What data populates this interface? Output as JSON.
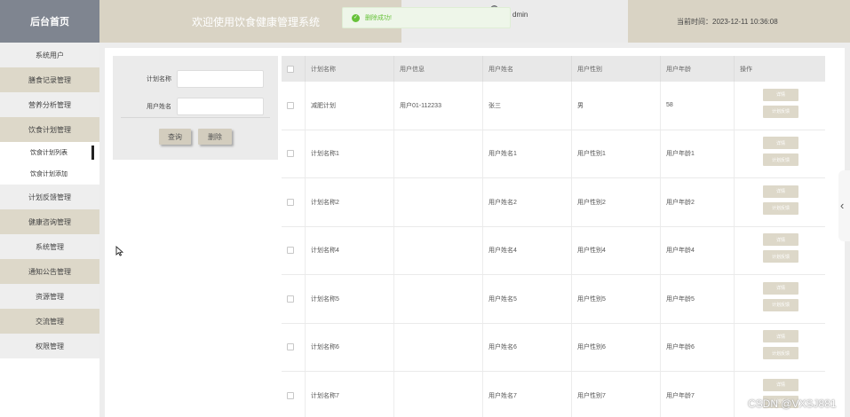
{
  "header": {
    "logo": "后台首页",
    "system_title": "欢迎使用饮食健康管理系统",
    "user_name": "dmin",
    "time_label": "当前时间：2023-12-11 10:36:08",
    "toast_message": "删除成功!"
  },
  "sidebar": {
    "items": [
      {
        "label": "系统用户"
      },
      {
        "label": "膳食记录管理"
      },
      {
        "label": "营养分析管理"
      },
      {
        "label": "饮食计划管理"
      },
      {
        "label": "饮食计划列表"
      },
      {
        "label": "饮食计划添加"
      },
      {
        "label": "计划反馈管理"
      },
      {
        "label": "健康咨询管理"
      },
      {
        "label": "系统管理"
      },
      {
        "label": "通知公告管理"
      },
      {
        "label": "资源管理"
      },
      {
        "label": "交流管理"
      },
      {
        "label": "权限管理"
      }
    ]
  },
  "search": {
    "plan_name_label": "计划名称",
    "plan_name_value": "",
    "user_name_label": "用户姓名",
    "user_name_value": "",
    "query_button": "查询",
    "delete_button": "删除"
  },
  "table": {
    "headers": [
      "计划名称",
      "用户信息",
      "用户姓名",
      "用户性别",
      "用户年龄",
      "操作"
    ],
    "rows": [
      {
        "plan": "减肥计划",
        "info": "用户01-112233",
        "name": "张三",
        "gender": "男",
        "age": "58"
      },
      {
        "plan": "计划名称1",
        "info": "",
        "name": "用户姓名1",
        "gender": "用户性别1",
        "age": "用户年龄1"
      },
      {
        "plan": "计划名称2",
        "info": "",
        "name": "用户姓名2",
        "gender": "用户性别2",
        "age": "用户年龄2"
      },
      {
        "plan": "计划名称4",
        "info": "",
        "name": "用户姓名4",
        "gender": "用户性别4",
        "age": "用户年龄4"
      },
      {
        "plan": "计划名称5",
        "info": "",
        "name": "用户姓名5",
        "gender": "用户性别5",
        "age": "用户年龄5"
      },
      {
        "plan": "计划名称6",
        "info": "",
        "name": "用户姓名6",
        "gender": "用户性别6",
        "age": "用户年龄6"
      },
      {
        "plan": "计划名称7",
        "info": "",
        "name": "用户姓名7",
        "gender": "用户性别7",
        "age": "用户年龄7"
      }
    ],
    "op_detail": "详情",
    "op_feedback": "计划反馈"
  },
  "watermark": "CSDN @VXSJ881",
  "colors": {
    "header_bg": "#d9d3c4",
    "logo_bg": "#7f8590",
    "menu_shade": "#ddd8c9",
    "toast_green": "#67c23a"
  }
}
